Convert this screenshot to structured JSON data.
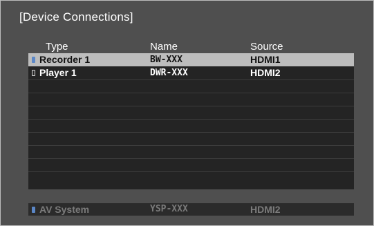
{
  "screen": {
    "title": "[Device Connections]"
  },
  "columns": {
    "type": "Type",
    "name": "Name",
    "source": "Source"
  },
  "devices": [
    {
      "type": "Recorder 1",
      "name": "BW-XXX",
      "source": "HDMI1",
      "icon": "device-filled-icon",
      "selected": true
    },
    {
      "type": "Player 1",
      "name": "DWR-XXX",
      "source": "HDMI2",
      "icon": "device-outline-icon",
      "selected": false
    }
  ],
  "av_system": {
    "type": "AV System",
    "name": "YSP-XXX",
    "source": "HDMI2",
    "icon": "device-filled-icon"
  },
  "colors": {
    "background": "#4f4f4f",
    "list_background": "#242424",
    "selected_row": "#bdbdbd",
    "icon_blue": "#5b87c7",
    "dimmed_text": "#7b7b7b"
  }
}
